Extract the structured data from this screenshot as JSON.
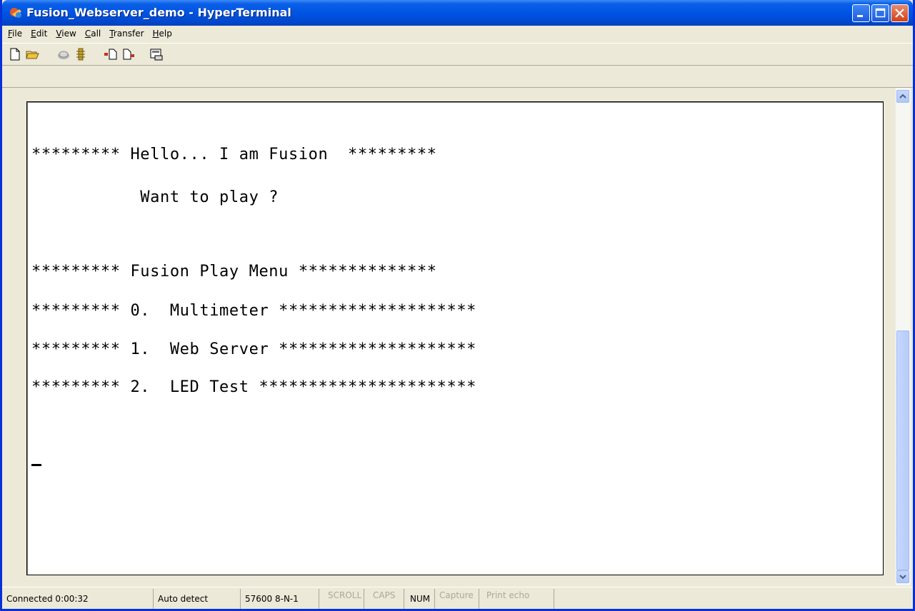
{
  "window": {
    "title": "Fusion_Webserver_demo - HyperTerminal"
  },
  "menu": [
    "File",
    "Edit",
    "View",
    "Call",
    "Transfer",
    "Help"
  ],
  "toolbar": {
    "icons": [
      "new-file-icon",
      "open-folder-icon",
      "dial-phone-icon",
      "disconnect-icon",
      "send-file-icon",
      "receive-file-icon",
      "properties-icon"
    ]
  },
  "terminal": {
    "lines": [
      "********* Hello... I am Fusion  *********",
      "           Want to play ?",
      "********* Fusion Play Menu **************",
      "********* 0.  Multimeter ********************",
      "********* 1.  Web Server ********************",
      "********* 2.  LED Test **********************"
    ],
    "cursor": "_"
  },
  "status": {
    "connected": "Connected 0:00:32",
    "detect": "Auto detect",
    "port": "57600 8-N-1",
    "scroll": "SCROLL",
    "caps": "CAPS",
    "num": "NUM",
    "capture": "Capture",
    "echo": "Print echo"
  },
  "colors": {
    "titlebar": "#0054e3",
    "close_button": "#d0411c",
    "terminal_bg": "#ffffff",
    "face": "#ece9d8"
  }
}
